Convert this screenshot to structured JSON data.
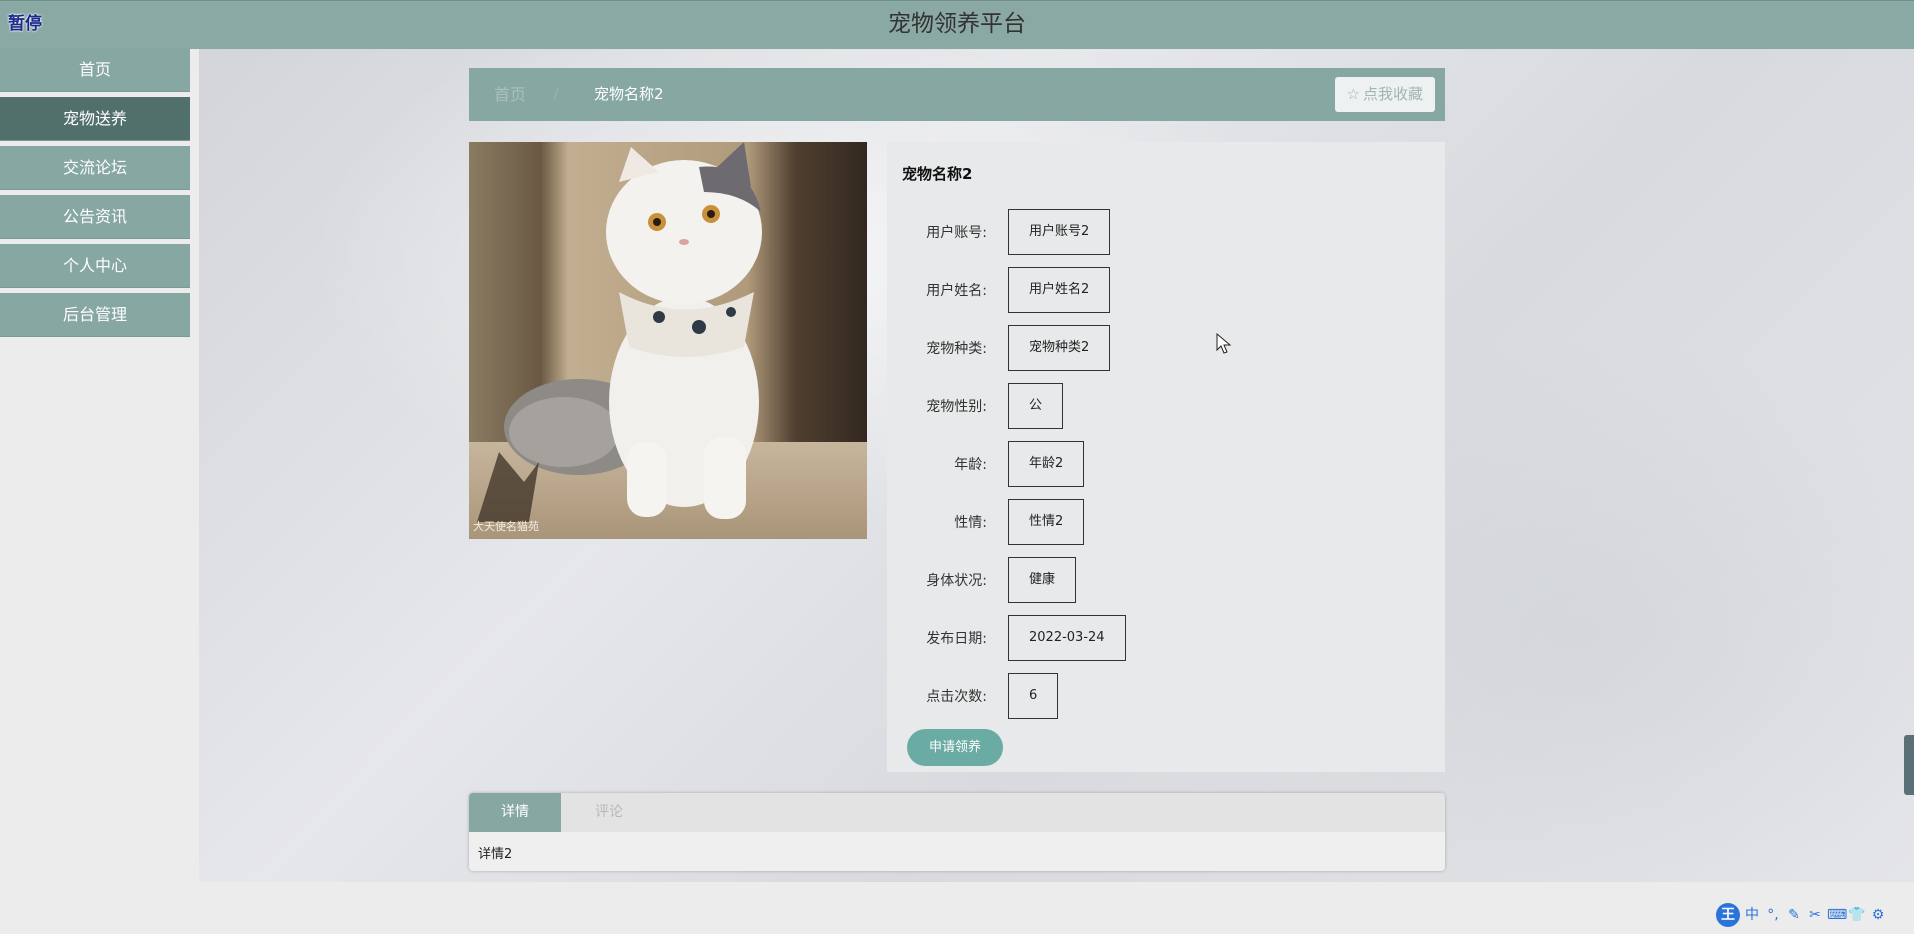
{
  "header": {
    "pause_label": "暂停",
    "site_title": "宠物领养平台"
  },
  "sidebar": {
    "items": [
      {
        "label": "首页"
      },
      {
        "label": "宠物送养"
      },
      {
        "label": "交流论坛"
      },
      {
        "label": "公告资讯"
      },
      {
        "label": "个人中心"
      },
      {
        "label": "后台管理"
      }
    ],
    "active_index": 1
  },
  "breadcrumb": {
    "home": "首页",
    "separator": "/",
    "current": "宠物名称2",
    "favorite_label": "点我收藏",
    "favorite_icon": "star-icon"
  },
  "pet": {
    "name": "宠物名称2",
    "fields": [
      {
        "label": "用户账号:",
        "value": "用户账号2"
      },
      {
        "label": "用户姓名:",
        "value": "用户姓名2"
      },
      {
        "label": "宠物种类:",
        "value": "宠物种类2"
      },
      {
        "label": "宠物性别:",
        "value": "公"
      },
      {
        "label": "年龄:",
        "value": "年龄2"
      },
      {
        "label": "性情:",
        "value": "性情2"
      },
      {
        "label": "身体状况:",
        "value": "健康"
      },
      {
        "label": "发布日期:",
        "value": "2022-03-24"
      },
      {
        "label": "点击次数:",
        "value": "6"
      }
    ],
    "adopt_button": "申请领养",
    "photo_caption": "大天使名猫苑"
  },
  "tabs": {
    "items": [
      {
        "label": "详情"
      },
      {
        "label": "评论"
      }
    ],
    "active_index": 0,
    "content": "详情2"
  },
  "ime_toolbar": {
    "logo": "王",
    "mode": "中",
    "icons": [
      "punctuation-icon",
      "pen-icon",
      "scissors-icon",
      "keyboard-icon",
      "skin-icon",
      "settings-icon"
    ]
  },
  "colors": {
    "theme": "#87a7a3",
    "theme_active": "#51706b",
    "adopt_button": "#6aaca3",
    "ime_blue": "#2a73d9"
  }
}
